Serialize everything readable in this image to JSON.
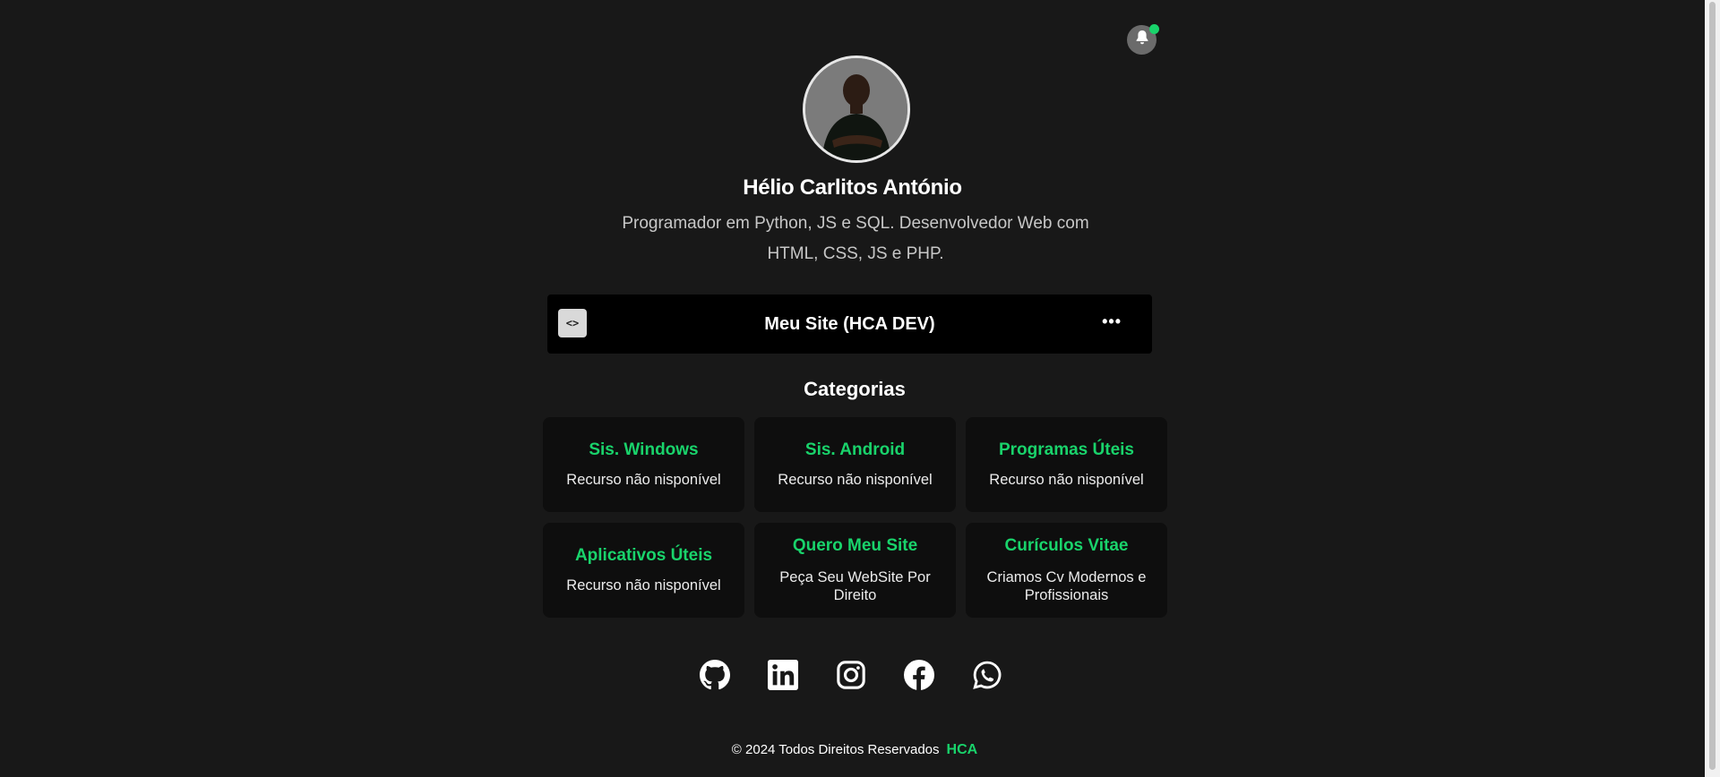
{
  "profile": {
    "name": "Hélio Carlitos António",
    "bio": "Programador em Python, JS e SQL. Desenvolvedor Web com HTML, CSS, JS e PHP."
  },
  "notification": {
    "icon": "bell-icon",
    "badge_color": "#19d36b"
  },
  "site_link": {
    "label": "Meu Site (HCA DEV)",
    "code_icon": "<>",
    "more_icon": "•••"
  },
  "categories": {
    "title": "Categorias",
    "items": [
      {
        "title": "Sis. Windows",
        "desc": "Recurso não nisponível"
      },
      {
        "title": "Sis. Android",
        "desc": "Recurso não nisponível"
      },
      {
        "title": "Programas Úteis",
        "desc": "Recurso não nisponível"
      },
      {
        "title": "Aplicativos Úteis",
        "desc": "Recurso não nisponível"
      },
      {
        "title": "Quero Meu Site",
        "desc": "Peça Seu WebSite Por Direito"
      },
      {
        "title": "Curículos Vitae",
        "desc": "Criamos Cv Modernos e Profissionais"
      }
    ]
  },
  "socials": [
    "github-icon",
    "linkedin-icon",
    "instagram-icon",
    "facebook-icon",
    "whatsapp-icon"
  ],
  "footer": {
    "text": "© 2024 Todos Direitos Reservados",
    "brand": "HCA"
  },
  "colors": {
    "accent": "#19d36b",
    "background": "#181818",
    "card": "#0e0e0e"
  }
}
